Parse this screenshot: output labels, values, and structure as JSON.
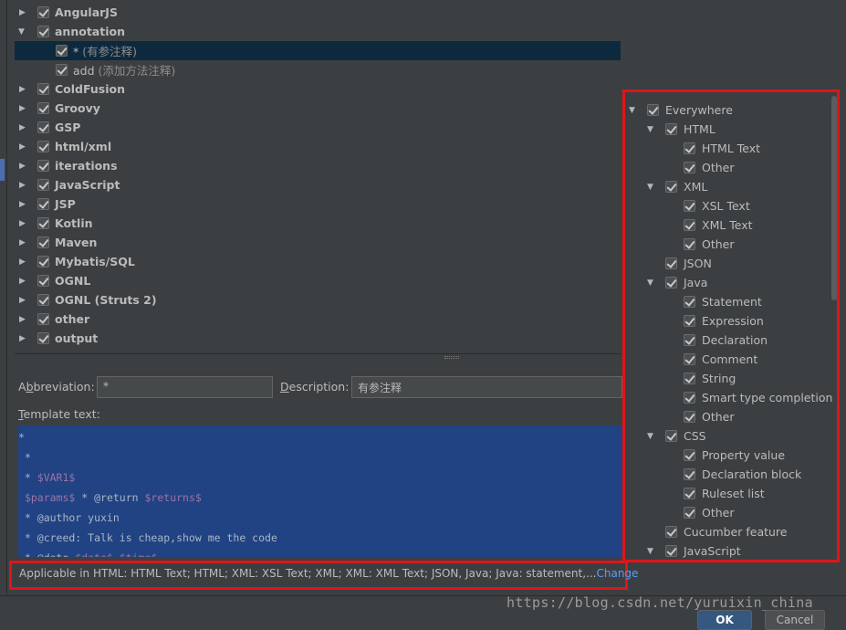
{
  "tree": {
    "top_group": {
      "label": "AngularJS"
    },
    "annotation_group": {
      "label": "annotation",
      "items": [
        {
          "name": "*",
          "desc": "(有参注释)",
          "selected": true
        },
        {
          "name": "add",
          "desc": "(添加方法注释)",
          "selected": false
        }
      ]
    },
    "groups": [
      "ColdFusion",
      "Groovy",
      "GSP",
      "html/xml",
      "iterations",
      "JavaScript",
      "JSP",
      "Kotlin",
      "Maven",
      "Mybatis/SQL",
      "OGNL",
      "OGNL (Struts 2)",
      "other",
      "output"
    ]
  },
  "form": {
    "abbreviation_label": "Abbreviation:",
    "abbreviation_mnemonic": "b",
    "abbreviation_value": "*",
    "description_label": "Description:",
    "description_mnemonic": "D",
    "description_value": "有参注释",
    "template_label": "Template text:",
    "template_mnemonic": "T"
  },
  "template_lines": [
    "*",
    " *",
    " * $VAR1$",
    " $params$ * @return $returns$",
    " * @author yuxin",
    " * @creed: Talk is cheap,show me the code",
    " * @date $date$ $time$"
  ],
  "applicable": {
    "text": "Applicable in HTML: HTML Text; HTML; XML: XSL Text; XML; XML: XML Text; JSON, Java; Java: statement,...",
    "change_label": "Change"
  },
  "contexts": [
    {
      "label": "Everywhere",
      "level": 0,
      "expanded": true
    },
    {
      "label": "HTML",
      "level": 1,
      "expanded": true
    },
    {
      "label": "HTML Text",
      "level": 2
    },
    {
      "label": "Other",
      "level": 2
    },
    {
      "label": "XML",
      "level": 1,
      "expanded": true
    },
    {
      "label": "XSL Text",
      "level": 2
    },
    {
      "label": "XML Text",
      "level": 2
    },
    {
      "label": "Other",
      "level": 2
    },
    {
      "label": "JSON",
      "level": 1
    },
    {
      "label": "Java",
      "level": 1,
      "expanded": true
    },
    {
      "label": "Statement",
      "level": 2
    },
    {
      "label": "Expression",
      "level": 2
    },
    {
      "label": "Declaration",
      "level": 2
    },
    {
      "label": "Comment",
      "level": 2
    },
    {
      "label": "String",
      "level": 2
    },
    {
      "label": "Smart type completion",
      "level": 2
    },
    {
      "label": "Other",
      "level": 2
    },
    {
      "label": "CSS",
      "level": 1,
      "expanded": true
    },
    {
      "label": "Property value",
      "level": 2
    },
    {
      "label": "Declaration block",
      "level": 2
    },
    {
      "label": "Ruleset list",
      "level": 2
    },
    {
      "label": "Other",
      "level": 2
    },
    {
      "label": "Cucumber feature",
      "level": 1
    },
    {
      "label": "JavaScript",
      "level": 1,
      "expanded": true
    }
  ],
  "buttons": {
    "ok": "OK",
    "cancel": "Cancel"
  },
  "watermark": "https://blog.csdn.net/yuruixin_china",
  "colors": {
    "highlight": "#e0141a",
    "selection": "#0d293e",
    "editor_bg": "#214283",
    "link": "#589df6"
  }
}
